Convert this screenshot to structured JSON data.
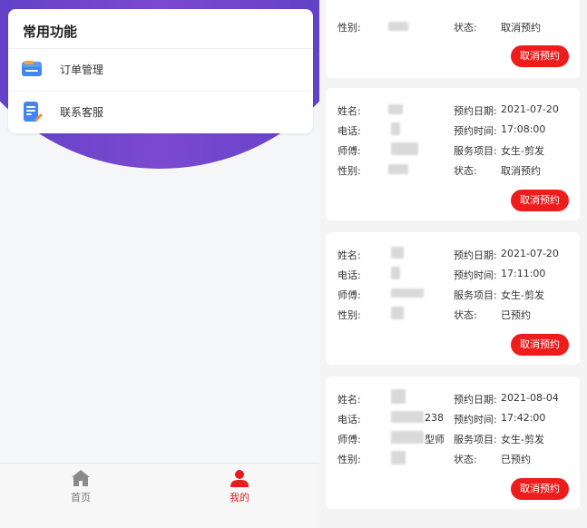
{
  "functions": {
    "title": "常用功能",
    "items": [
      {
        "label": "订单管理",
        "icon": "order-card-icon"
      },
      {
        "label": "联系客服",
        "icon": "customer-service-icon"
      }
    ]
  },
  "nav": {
    "home_label": "首页",
    "mine_label": "我的"
  },
  "orders": {
    "labels": {
      "name": "姓名:",
      "phone": "电话:",
      "stylist": "师傅:",
      "gender": "性别:",
      "date": "预约日期:",
      "time": "预约时间:",
      "service": "服务项目:",
      "status": "状态:"
    },
    "cancel_label": "取消预约",
    "cards": [
      {
        "status": "取消预约"
      },
      {
        "date": "2021-07-20",
        "time": "17:08:00",
        "service": "女生-剪发",
        "status": "取消预约"
      },
      {
        "date": "2021-07-20",
        "time": "17:11:00",
        "service": "女生-剪发",
        "status": "已预约"
      },
      {
        "phone_suffix": "238",
        "stylist_suffix": "型师",
        "date": "2021-08-04",
        "time": "17:42:00",
        "service": "女生-剪发",
        "status": "已预约"
      }
    ]
  },
  "colors": {
    "accent_red": "#ef1c1c",
    "purple": "#6a45cc"
  }
}
